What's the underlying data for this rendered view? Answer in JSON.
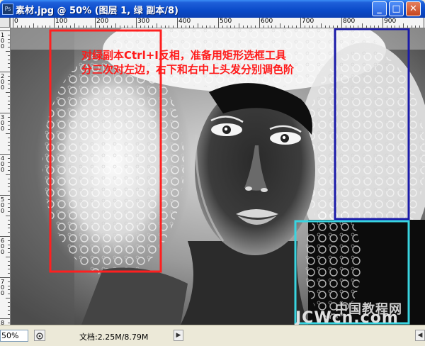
{
  "window": {
    "title": "素材.jpg @ 50% (图层 1, 绿 副本/8)",
    "app_icon_label": "Ps",
    "minimize_glyph": "_",
    "maximize_glyph": "□",
    "close_glyph": "✕"
  },
  "ruler": {
    "top_labels": [
      "0",
      "100",
      "200",
      "300",
      "400",
      "500",
      "600",
      "700",
      "800",
      "900",
      "10"
    ],
    "left_labels": [
      "1",
      "0",
      "0",
      "2",
      "0",
      "0",
      "3",
      "0",
      "0",
      "4",
      "0",
      "0",
      "5",
      "0",
      "0",
      "6",
      "0",
      "0",
      "7",
      "0",
      "0",
      "8",
      "0",
      "0"
    ]
  },
  "annotation": {
    "line1": "对绿副本Ctrl+I反相，准备用矩形选框工具",
    "line2": "分三次对左边，右下和右中上头发分别调色阶",
    "text_color": "#ff1a1a"
  },
  "selections": {
    "left_color": "#ff1f1f",
    "top_right_color": "#1a1aa8",
    "bottom_right_color": "#39d4e0"
  },
  "watermark": {
    "line1": "中国教程网",
    "line2": "JCWcn.com"
  },
  "statusbar": {
    "zoom": "50%",
    "doc_info": "文档:2.25M/8.79M",
    "arrow_right": "▶",
    "arrow_left": "◀"
  }
}
